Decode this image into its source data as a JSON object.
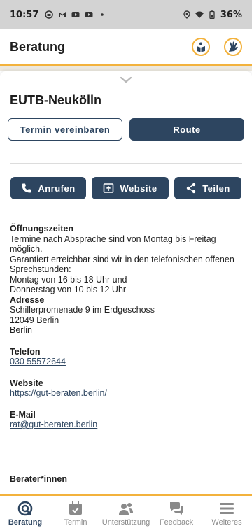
{
  "statusbar": {
    "time": "10:57",
    "battery": "36%"
  },
  "header": {
    "title": "Beratung"
  },
  "place": {
    "name": "EUTB-Neukölln"
  },
  "buttons": {
    "appointment": "Termin vereinbaren",
    "route": "Route",
    "call": "Anrufen",
    "website": "Website",
    "share": "Teilen"
  },
  "info": {
    "opening_label": "Öffnungszeiten",
    "opening_text": [
      "Termine nach Absprache sind von Montag bis Freitag möglich.",
      "Garantiert erreichbar sind wir in den telefonischen offenen Sprechstunden:",
      "Montag von 16 bis 18 Uhr und",
      "Donnerstag von 10 bis 12 Uhr"
    ],
    "address_label": "Adresse",
    "address_lines": [
      "Schillerpromenade 9 im Erdgeschoss",
      "12049 Berlin",
      "Berlin"
    ],
    "phone_label": "Telefon",
    "phone": "030 55572644",
    "website_label": "Website",
    "website": "https://gut-beraten.berlin/",
    "email_label": "E-Mail",
    "email": "rat@gut-beraten.berlin",
    "counselors_label": "Berater*innen"
  },
  "nav": [
    {
      "label": "Beratung",
      "icon": "counseling-icon",
      "active": true
    },
    {
      "label": "Termin",
      "icon": "calendar-icon",
      "active": false
    },
    {
      "label": "Unterstützung",
      "icon": "support-icon",
      "active": false
    },
    {
      "label": "Feedback",
      "icon": "feedback-icon",
      "active": false
    },
    {
      "label": "Weiteres",
      "icon": "menu-icon",
      "active": false
    }
  ],
  "colors": {
    "primary": "#2d4560",
    "accent": "#f3b23c",
    "statusbar": "#d3d3d3"
  }
}
